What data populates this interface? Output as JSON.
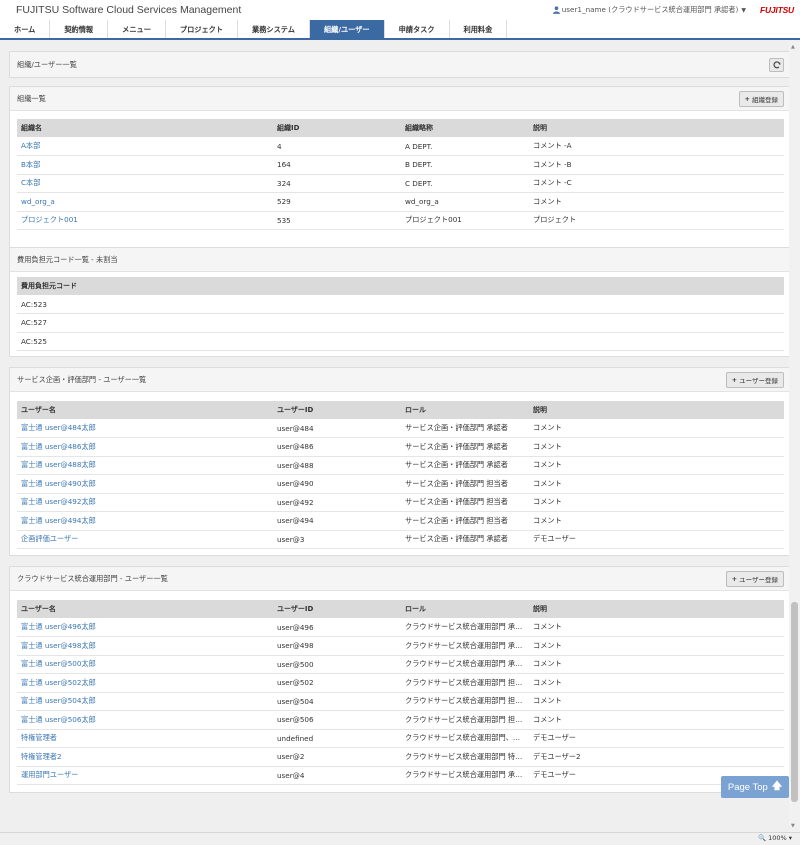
{
  "app": {
    "title": "FUJITSU Software Cloud Services Management",
    "user": "user1_name (クラウドサービス統合運用部門 承認者)",
    "logo": "FUJITSU"
  },
  "nav": [
    {
      "label": "ホーム"
    },
    {
      "label": "契約情報"
    },
    {
      "label": "メニュー"
    },
    {
      "label": "プロジェクト"
    },
    {
      "label": "業務システム"
    },
    {
      "label": "組織/ユーザー",
      "active": true
    },
    {
      "label": "申請タスク"
    },
    {
      "label": "利用料金"
    }
  ],
  "breadcrumb": {
    "title": "組織/ユーザー一覧"
  },
  "org": {
    "title": "組織一覧",
    "button": "組織登録",
    "columns": [
      "組織名",
      "組織ID",
      "組織略称",
      "説明"
    ],
    "rows": [
      [
        "A本部",
        "4",
        "A DEPT.",
        "コメント -A"
      ],
      [
        "B本部",
        "164",
        "B DEPT.",
        "コメント -B"
      ],
      [
        "C本部",
        "324",
        "C DEPT.",
        "コメント -C"
      ],
      [
        "wd_org_a",
        "529",
        "wd_org_a",
        "コメント"
      ],
      [
        "プロジェクト001",
        "535",
        "プロジェクト001",
        "プロジェクト"
      ]
    ]
  },
  "cost": {
    "title": "費用負担元コード一覧 - 未割当",
    "columns": [
      "費用負担元コード"
    ],
    "rows": [
      [
        "AC:523"
      ],
      [
        "AC:527"
      ],
      [
        "AC:525"
      ]
    ]
  },
  "svc": {
    "title": "サービス企画・評価部門 - ユーザー一覧",
    "button": "ユーザー登録",
    "columns": [
      "ユーザー名",
      "ユーザーID",
      "ロール",
      "説明"
    ],
    "rows": [
      [
        "富士通 user@484太郎",
        "user@484",
        "サービス企画・評価部門 承認者",
        "コメント"
      ],
      [
        "富士通 user@486太郎",
        "user@486",
        "サービス企画・評価部門 承認者",
        "コメント"
      ],
      [
        "富士通 user@488太郎",
        "user@488",
        "サービス企画・評価部門 承認者",
        "コメント"
      ],
      [
        "富士通 user@490太郎",
        "user@490",
        "サービス企画・評価部門 担当者",
        "コメント"
      ],
      [
        "富士通 user@492太郎",
        "user@492",
        "サービス企画・評価部門 担当者",
        "コメント"
      ],
      [
        "富士通 user@494太郎",
        "user@494",
        "サービス企画・評価部門 担当者",
        "コメント"
      ],
      [
        "企画評価ユーザー",
        "user@3",
        "サービス企画・評価部門 承認者",
        "デモユーザー"
      ]
    ]
  },
  "cloud": {
    "title": "クラウドサービス統合運用部門 - ユーザー一覧",
    "button": "ユーザー登録",
    "columns": [
      "ユーザー名",
      "ユーザーID",
      "ロール",
      "説明"
    ],
    "rows": [
      [
        "富士通 user@496太郎",
        "user@496",
        "クラウドサービス統合運用部門 承認者",
        "コメント"
      ],
      [
        "富士通 user@498太郎",
        "user@498",
        "クラウドサービス統合運用部門 承認者",
        "コメント"
      ],
      [
        "富士通 user@500太郎",
        "user@500",
        "クラウドサービス統合運用部門 承認者",
        "コメント"
      ],
      [
        "富士通 user@502太郎",
        "user@502",
        "クラウドサービス統合運用部門 担当者",
        "コメント"
      ],
      [
        "富士通 user@504太郎",
        "user@504",
        "クラウドサービス統合運用部門 担当者",
        "コメント"
      ],
      [
        "富士通 user@506太郎",
        "user@506",
        "クラウドサービス統合運用部門 担当者",
        "コメント"
      ],
      [
        "特権管理者",
        "undefined",
        "クラウドサービス統合運用部門、特権管理者",
        "デモユーザー"
      ],
      [
        "特権管理者2",
        "user@2",
        "クラウドサービス統合運用部門 特権管理者",
        "デモユーザー2"
      ],
      [
        "運用部門ユーザー",
        "user@4",
        "クラウドサービス統合運用部門 承認者",
        "デモユーザー"
      ]
    ]
  },
  "page_top": "Page Top",
  "zoom": "100%"
}
